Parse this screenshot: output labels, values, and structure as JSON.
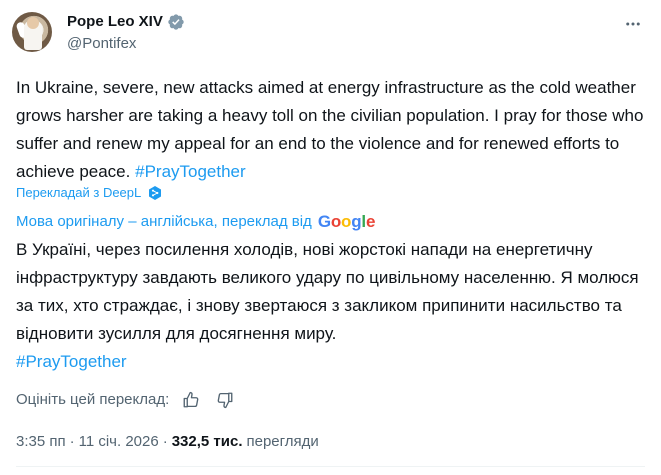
{
  "author": {
    "display_name": "Pope Leo XIV",
    "handle": "@Pontifex",
    "verified": true,
    "verified_color": "#829aab"
  },
  "tweet": {
    "text": "In Ukraine, severe, new attacks aimed at energy infrastructure as the cold weather grows harsher are taking a heavy toll on the civilian population. I pray for those who suffer and renew my appeal for an end to the violence and for renewed efforts to achieve peace.",
    "hashtag": "#PrayTogether"
  },
  "translation": {
    "deepl_label": "Перекладай з DeepL",
    "deepl_icon": "deepl-icon",
    "original_language_label": "Мова оригіналу – англійська, переклад від",
    "google_logo": [
      "G",
      "o",
      "o",
      "g",
      "l",
      "e"
    ],
    "text": "В Україні, через посилення холодів, нові жорстокі напади на енергетичну інфраструктуру завдають великого удару по цивільному населенню. Я молюся за тих, хто страждає, і знову звертаюся з закликом припинити насильство та відновити зусилля для досягнення миру.",
    "hashtag": "#PrayTogether",
    "rate_label": "Оцініть цей переклад:"
  },
  "meta": {
    "time": "3:35 пп",
    "separator": "·",
    "date": "11 січ. 2026",
    "views_count": "332,5 тис.",
    "views_label": "перегляди"
  },
  "colors": {
    "link": "#1d9bf0",
    "text": "#0f1419",
    "secondary": "#536471"
  }
}
